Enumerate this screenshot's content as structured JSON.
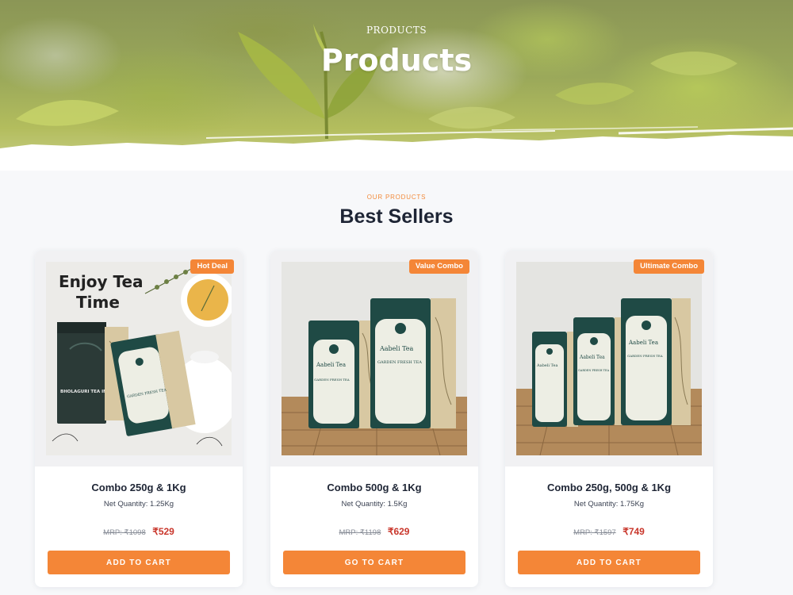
{
  "hero": {
    "breadcrumb": "PRODUCTS",
    "title": "Products"
  },
  "section": {
    "eyebrow": "OUR PRODUCTS",
    "title": "Best Sellers"
  },
  "colors": {
    "accent": "#f48637",
    "price": "#c9372c",
    "heading": "#1e2535",
    "pouch": "#1f4a45"
  },
  "products": [
    {
      "badge": "Hot Deal",
      "name": "Combo 250g & 1Kg",
      "quantity": "Net Quantity: 1.25Kg",
      "mrp": "MRP: ₹1098",
      "price": "₹529",
      "button": "ADD TO CART",
      "image_text": {
        "headline_1": "Enjoy Tea",
        "headline_2": "Time",
        "pouch_text": "BHOLAGURI TEA INDUSTRIES",
        "pouch_label": "GARDEN FRESH TEA"
      }
    },
    {
      "badge": "Value Combo",
      "name": "Combo 500g & 1Kg",
      "quantity": "Net Quantity: 1.5Kg",
      "mrp": "MRP: ₹1198",
      "price": "₹629",
      "button": "GO TO CART",
      "image_text": {
        "brand": "Aabeli Tea",
        "pouch_label": "GARDEN FRESH TEA"
      }
    },
    {
      "badge": "Ultimate Combo",
      "name": "Combo 250g, 500g & 1Kg",
      "quantity": "Net Quantity: 1.75Kg",
      "mrp": "MRP: ₹1597",
      "price": "₹749",
      "button": "ADD TO CART",
      "image_text": {
        "brand": "Aabeli Tea",
        "pouch_label": "GARDEN FRESH TEA"
      }
    }
  ]
}
